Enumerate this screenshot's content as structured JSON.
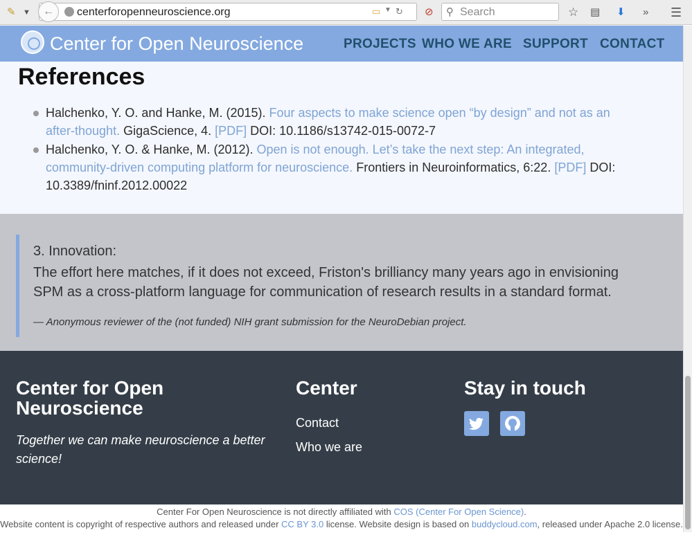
{
  "browser": {
    "url": "centerforopenneuroscience.org",
    "search_placeholder": "Search"
  },
  "nav": {
    "brand": "Center for Open Neuroscience",
    "links": [
      "PROJECTS",
      "WHO WE ARE",
      "SUPPORT",
      "CONTACT"
    ]
  },
  "references": {
    "heading": "References",
    "items": [
      {
        "authors": "Halchenko, Y. O. and Hanke, M. (2015). ",
        "title": "Four aspects to make science open “by design” and not as an after-thought.",
        "journal": " GigaScience, 4. ",
        "pdf": "[PDF]",
        "doi": " DOI: 10.1186/s13742-015-0072-7"
      },
      {
        "authors": "Halchenko, Y. O. & Hanke, M. (2012). ",
        "title": "Open is not enough. Let’s take the next step: An integrated, community-driven computing platform for neuroscience.",
        "journal": " Frontiers in Neuroinformatics, 6:22. ",
        "pdf": "[PDF]",
        "doi": " DOI: 10.3389/fninf.2012.00022"
      }
    ]
  },
  "quote": {
    "title": "3. Innovation:",
    "body": "The effort here matches, if it does not exceed, Friston's brilliancy many years ago in envisioning SPM as a cross-platform language for communication of research results in a standard format.",
    "citation": "— Anonymous reviewer of the (not funded) NIH grant submission for the NeuroDebian project."
  },
  "footer": {
    "col1_heading": "Center for Open Neuroscience",
    "tagline": "Together we can make neuroscience a better science!",
    "col2_heading": "Center",
    "col2_links": [
      "Contact",
      "Who we are"
    ],
    "col3_heading": "Stay in touch",
    "social": [
      "twitter-icon",
      "github-icon"
    ]
  },
  "bottom": {
    "line1_pre": "Center For Open Neuroscience is not directly affiliated with ",
    "line1_link": "COS (Center For Open Science)",
    "line1_post": ".",
    "line2_pre": "Website content is copyright of respective authors and released under ",
    "line2_link1": "CC BY 3.0",
    "line2_mid": " license. Website design is based on ",
    "line2_link2": "buddycloud.com",
    "line2_post": ", released under Apache 2.0 license."
  },
  "colors": {
    "accent": "#84a9e0",
    "nav_text": "#224f6c",
    "footer_bg": "#353e48",
    "quote_bg": "#c3c5cb",
    "link": "#7fa4d4"
  }
}
